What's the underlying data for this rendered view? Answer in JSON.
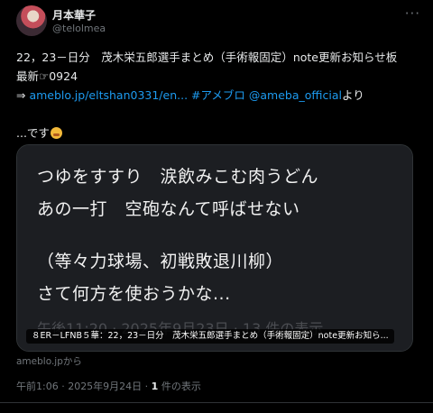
{
  "post": {
    "author_name": "月本華子",
    "author_handle": "@telolmea",
    "more_glyph": "···",
    "text_line1": "22，23－日分　茂木栄五郎選手まとめ（手術報固定）note更新お知らせ板",
    "text_line2": "最新☞0924",
    "text_line3_prefix": "⇒ ",
    "link_url": "ameblo.jp/eltshan0331/en...",
    "hashtag": "#アメブロ",
    "mention": "@ameba_official",
    "text_line3_suffix": "より",
    "text_line4": "...です"
  },
  "card": {
    "image_lines": [
      "つゆをすすり　涙飲みこむ肉うどん",
      "あの一打　空砲なんて呼ばせない",
      "（等々力球場、初戦敗退川柳）",
      "さて何方を使おうかな..."
    ],
    "image_faded": "午後11:20 · 2025年9月23日 · 13 件の表示",
    "title": "８ER－LFNB５華：22，23－日分　茂木栄五郎選手まとめ（手術報固定）note更新お知ら..."
  },
  "source_label": "ameblo.jpから",
  "meta": {
    "timestamp": "午前1:06 · 2025年9月24日 · ",
    "views_count": "1",
    "views_label": " 件の表示"
  },
  "colors": {
    "background": "#000000",
    "text": "#e7e9ea",
    "secondary": "#71767b",
    "link": "#1d9bf0",
    "border": "#2f3336"
  }
}
